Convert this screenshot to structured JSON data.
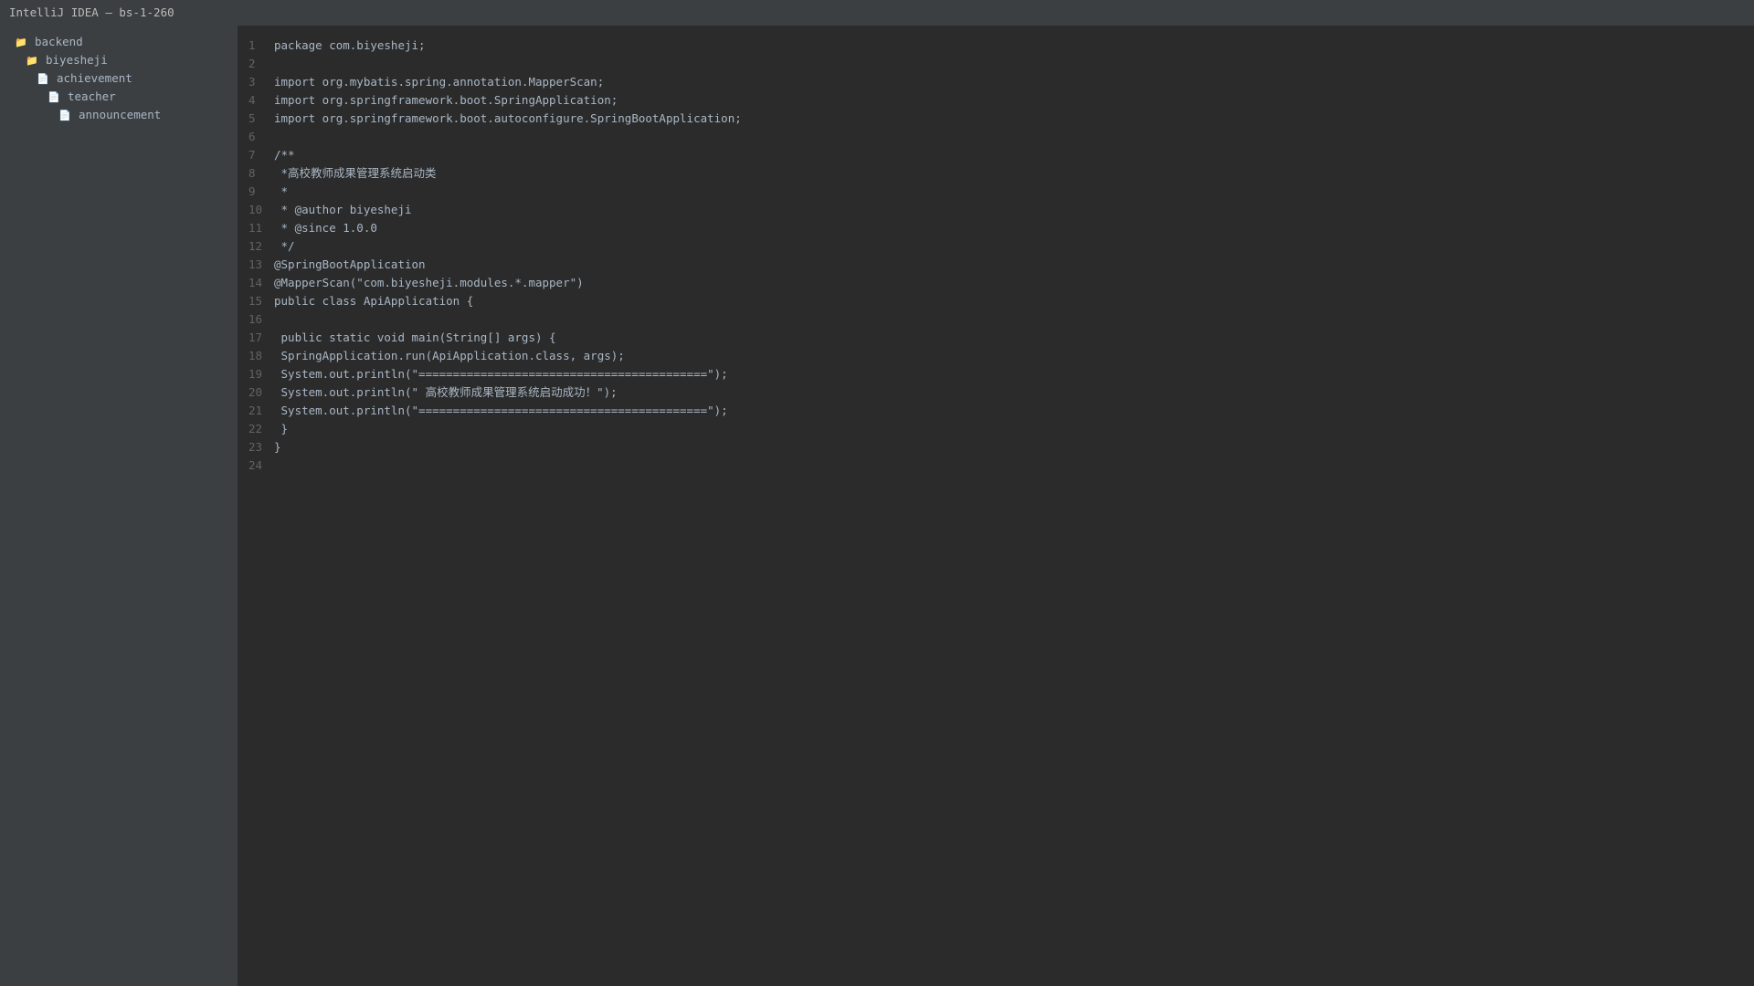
{
  "window": {
    "title": "IntelliJ IDEA — bs-1-260"
  },
  "sidebar": {
    "items": [
      {
        "label": "backend",
        "icon": "folder-icon",
        "depth": 0
      },
      {
        "label": "biyesheji",
        "icon": "folder-icon",
        "depth": 1
      },
      {
        "label": "achievement",
        "icon": "file-icon",
        "depth": 2
      },
      {
        "label": "teacher",
        "icon": "file-icon",
        "depth": 3
      },
      {
        "label": "announcement",
        "icon": "file-icon",
        "depth": 4
      }
    ]
  },
  "editor": {
    "lines": [
      {
        "num": "1",
        "text": "package com.biyesheji;"
      },
      {
        "num": "2",
        "text": ""
      },
      {
        "num": "3",
        "text": "import org.mybatis.spring.annotation.MapperScan;"
      },
      {
        "num": "4",
        "text": "import org.springframework.boot.SpringApplication;"
      },
      {
        "num": "5",
        "text": "import org.springframework.boot.autoconfigure.SpringBootApplication;"
      },
      {
        "num": "6",
        "text": ""
      },
      {
        "num": "7",
        "text": "/**"
      },
      {
        "num": "8",
        "text": " *高校教师成果管理系统启动类"
      },
      {
        "num": "9",
        "text": " *"
      },
      {
        "num": "10",
        "text": " * @author biyesheji"
      },
      {
        "num": "11",
        "text": " * @since 1.0.0"
      },
      {
        "num": "12",
        "text": " */"
      },
      {
        "num": "13",
        "text": "@SpringBootApplication"
      },
      {
        "num": "14",
        "text": "@MapperScan(\"com.biyesheji.modules.*.mapper\")"
      },
      {
        "num": "15",
        "text": "public class ApiApplication {"
      },
      {
        "num": "16",
        "text": ""
      },
      {
        "num": "17",
        "text": " public static void main(String[] args) {"
      },
      {
        "num": "18",
        "text": " SpringApplication.run(ApiApplication.class, args);"
      },
      {
        "num": "19",
        "text": " System.out.println(\"==========================================\");"
      },
      {
        "num": "20",
        "text": " System.out.println(\" 高校教师成果管理系统启动成功！\");"
      },
      {
        "num": "21",
        "text": " System.out.println(\"==========================================\");"
      },
      {
        "num": "22",
        "text": " }"
      },
      {
        "num": "23",
        "text": "}"
      },
      {
        "num": "24",
        "text": ""
      }
    ]
  },
  "colors": {
    "titlebar_bg": "#3c3f41",
    "sidebar_bg": "#3c3f41",
    "editor_bg": "#2b2b2b",
    "code_text": "#a9b7c6",
    "line_number": "#606366",
    "folder_icon": "#e8bf6a"
  }
}
